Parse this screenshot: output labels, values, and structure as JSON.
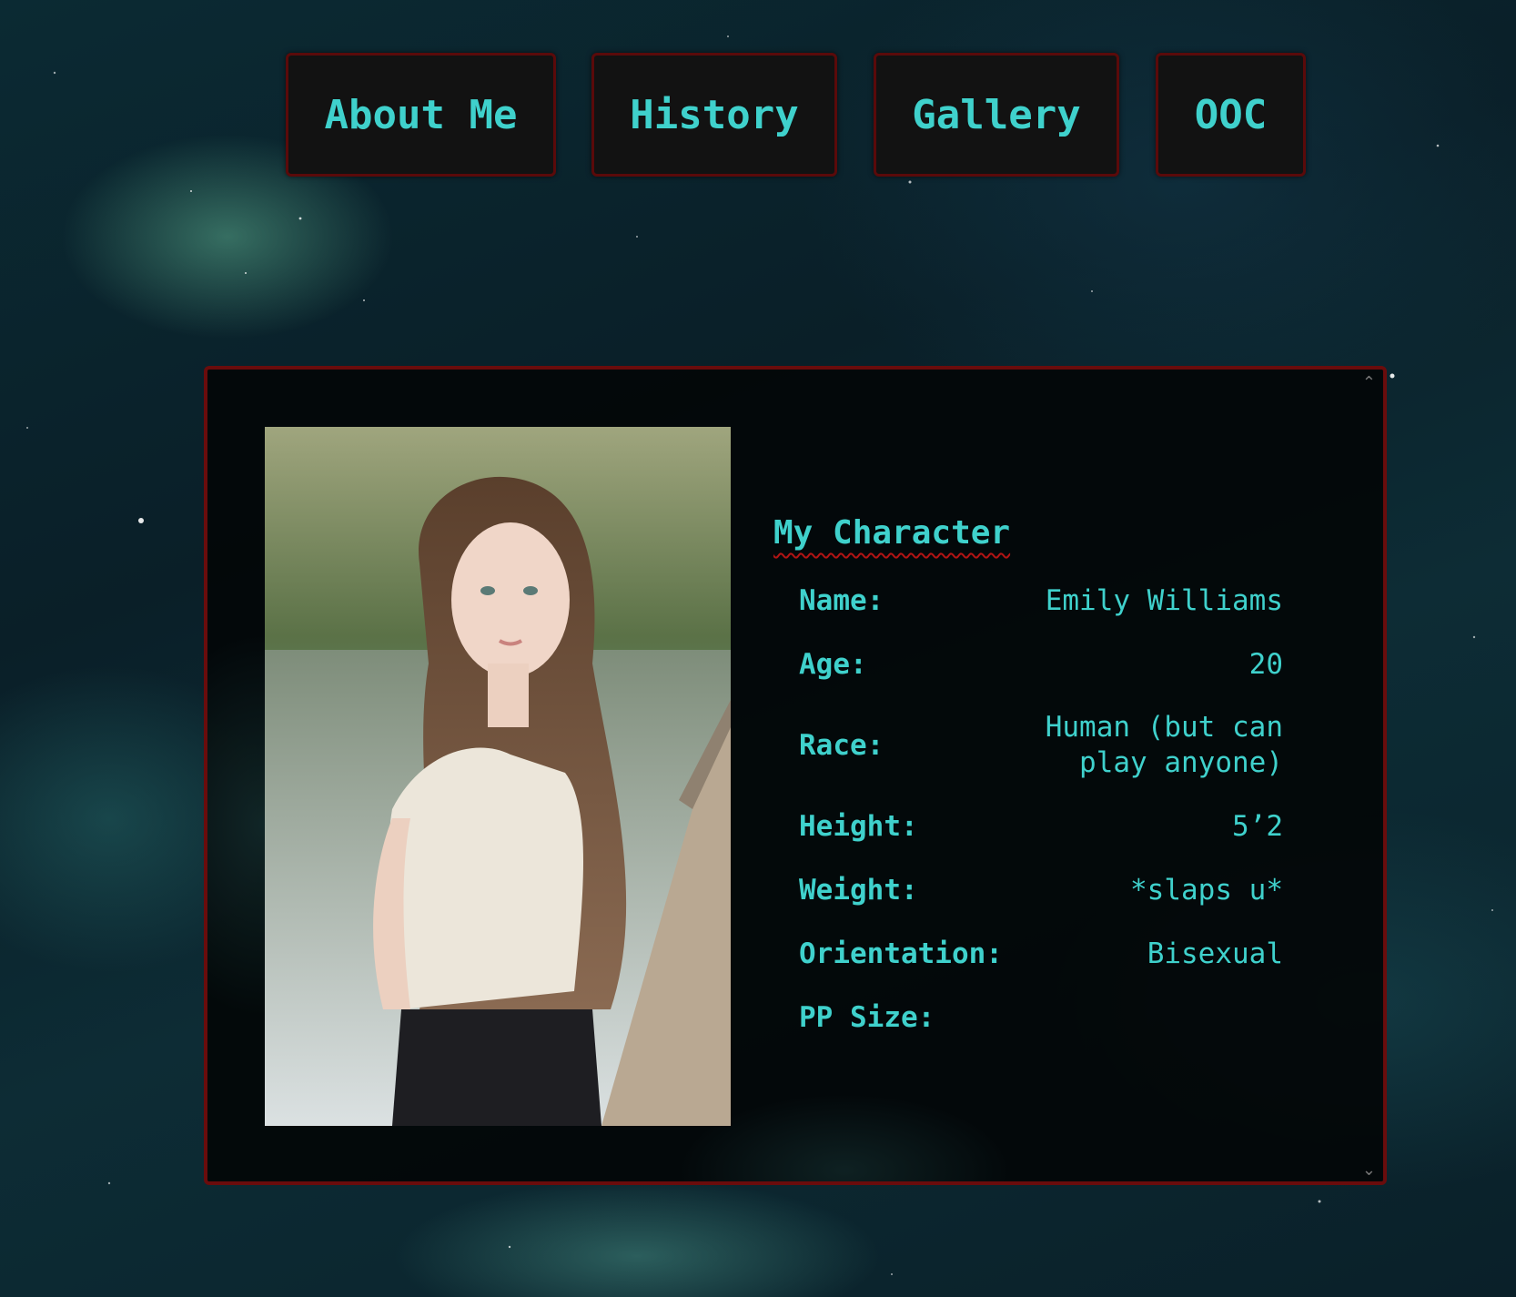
{
  "nav": {
    "items": [
      {
        "label": "About Me"
      },
      {
        "label": "History"
      },
      {
        "label": "Gallery"
      },
      {
        "label": "OOC"
      }
    ]
  },
  "profile": {
    "title": "My Character",
    "fields": [
      {
        "label": "Name:",
        "value": "Emily Williams"
      },
      {
        "label": "Age:",
        "value": "20"
      },
      {
        "label": "Race:",
        "value": "Human (but can play anyone)"
      },
      {
        "label": "Height:",
        "value": "5’2"
      },
      {
        "label": "Weight:",
        "value": "*slaps u*"
      },
      {
        "label": "Orientation:",
        "value": "Bisexual"
      },
      {
        "label": "PP Size:",
        "value": ""
      }
    ]
  },
  "scroll": {
    "up_icon": "chevron-up-icon",
    "down_icon": "chevron-down-icon"
  },
  "colors": {
    "accent": "#3fd1cc",
    "border": "#6a0c0c",
    "underline": "#b11414"
  }
}
